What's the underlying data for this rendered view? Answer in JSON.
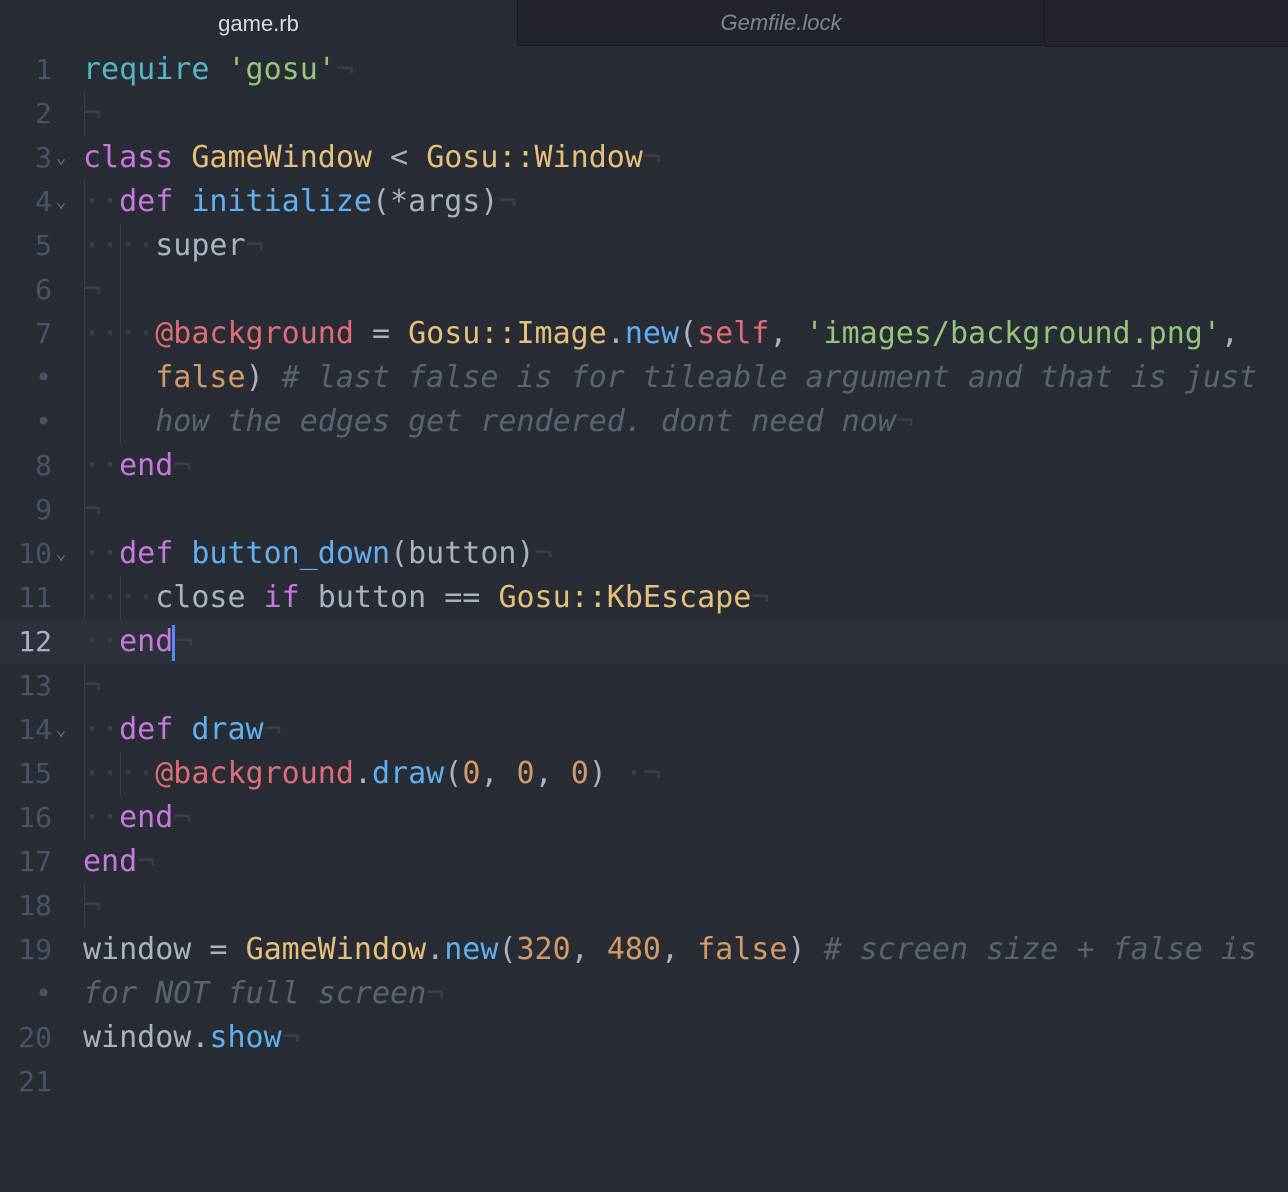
{
  "tabs": [
    {
      "label": "game.rb",
      "active": true
    },
    {
      "label": "Gemfile.lock",
      "active": false
    }
  ],
  "gutter": {
    "numbers": [
      "1",
      "2",
      "3",
      "4",
      "5",
      "6",
      "7",
      "•",
      "•",
      "8",
      "9",
      "10",
      "11",
      "12",
      "13",
      "14",
      "15",
      "16",
      "17",
      "18",
      "19",
      "•",
      "20",
      "21"
    ],
    "current_line": "12"
  },
  "code": {
    "l1_require": "require",
    "l1_str": "'gosu'",
    "l3_class": "class",
    "l3_name": "GameWindow",
    "l3_lt": " < ",
    "l3_super": "Gosu::Window",
    "l4_def": "def",
    "l4_name": "initialize",
    "l4_args": "(*args)",
    "l5_super": "super",
    "l7_ivar": "@background",
    "l7_eq": " = ",
    "l7_cls": "Gosu::Image",
    "l7_dot": ".",
    "l7_new": "new",
    "l7_open": "(",
    "l7_self": "self",
    "l7_comma": ", ",
    "l7_str": "'images/background.png'",
    "l7_comma2": ",",
    "l7b_false": "false",
    "l7b_close": ")",
    "l7b_comment": "# last false is for tileable argument and that is just",
    "l7c_comment": "how the edges get rendered. dont need now",
    "l8_end": "end",
    "l10_def": "def",
    "l10_name": "button_down",
    "l10_args": "(button)",
    "l11_close": "close ",
    "l11_if": "if",
    "l11_rest": " button == ",
    "l11_cls": "Gosu::KbEscape",
    "l12_end": "end",
    "l14_def": "def",
    "l14_name": "draw",
    "l15_ivar": "@background",
    "l15_dot": ".",
    "l15_draw": "draw",
    "l15_open": "(",
    "l15_n1": "0",
    "l15_c1": ", ",
    "l15_n2": "0",
    "l15_c2": ", ",
    "l15_n3": "0",
    "l15_close": ")",
    "l16_end": "end",
    "l17_end": "end",
    "l19_window": "window = ",
    "l19_cls": "GameWindow",
    "l19_dot": ".",
    "l19_new": "new",
    "l19_open": "(",
    "l19_n1": "320",
    "l19_c1": ", ",
    "l19_n2": "480",
    "l19_c2": ", ",
    "l19_false": "false",
    "l19_close": ")",
    "l19_comment": "# screen size + false is",
    "l19b_comment": "for NOT full screen",
    "l20_window": "window",
    "l20_dot": ".",
    "l20_show": "show"
  },
  "invisibles": {
    "eol": "¬",
    "space": "·"
  },
  "colors": {
    "background": "#282c34",
    "keyword": "#c678dd",
    "function": "#61afef",
    "string": "#98c379",
    "class": "#e5c07b",
    "ivar": "#e06c75",
    "number": "#d19a66",
    "comment": "#5c6370",
    "caret": "#528bff"
  },
  "icons": {
    "fold": "chevron-down-icon"
  }
}
